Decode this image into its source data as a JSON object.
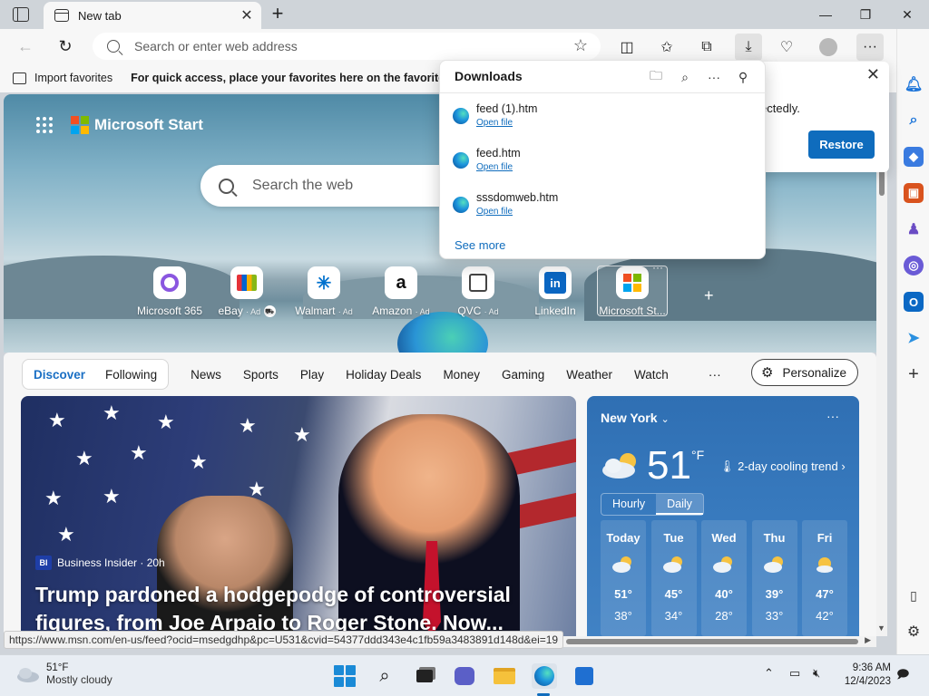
{
  "browser": {
    "tab_title": "New tab",
    "address_placeholder": "Search or enter web address",
    "favorites": {
      "import_label": "Import favorites",
      "hint": "For quick access, place your favorites here on the favorites bar."
    },
    "status_url": "https://www.msn.com/en-us/feed?ocid=msedgdhp&pc=U531&cvid=54377ddd343e4c1fb59a3483891d148d&ei=19"
  },
  "notice": {
    "text_fragment": "ectedly.",
    "restore_label": "Restore"
  },
  "downloads": {
    "title": "Downloads",
    "items": [
      {
        "name": "feed (1).htm",
        "action": "Open file"
      },
      {
        "name": "feed.htm",
        "action": "Open file"
      },
      {
        "name": "sssdomweb.htm",
        "action": "Open file"
      }
    ],
    "see_more": "See more"
  },
  "start_page": {
    "brand": "Microsoft Start",
    "search_placeholder": "Search the web",
    "quick_links": [
      {
        "label": "Microsoft 365",
        "ad": ""
      },
      {
        "label": "eBay",
        "ad": "· Ad"
      },
      {
        "label": "Walmart",
        "ad": "· Ad"
      },
      {
        "label": "Amazon",
        "ad": "· Ad"
      },
      {
        "label": "QVC",
        "ad": "· Ad"
      },
      {
        "label": "LinkedIn",
        "ad": ""
      },
      {
        "label": "Microsoft St...",
        "ad": ""
      }
    ],
    "feed_tabs": {
      "primary": [
        "Discover",
        "Following"
      ],
      "categories": [
        "News",
        "Sports",
        "Play",
        "Holiday Deals",
        "Money",
        "Gaming",
        "Weather",
        "Watch"
      ],
      "more": "···",
      "personalize": "Personalize"
    },
    "news": {
      "source_badge": "BI",
      "source": "Business Insider · 20h",
      "headline": "Trump pardoned a hodgepodge of controversial figures, from Joe Arpaio to Roger Stone. Now..."
    },
    "weather": {
      "city": "New York",
      "temp": "51",
      "unit": "°F",
      "trend": "2-day cooling trend",
      "tabs": [
        "Hourly",
        "Daily"
      ],
      "days": [
        {
          "day": "Today",
          "hi": "51°",
          "lo": "38°"
        },
        {
          "day": "Tue",
          "hi": "45°",
          "lo": "34°"
        },
        {
          "day": "Wed",
          "hi": "40°",
          "lo": "28°"
        },
        {
          "day": "Thu",
          "hi": "39°",
          "lo": "33°"
        },
        {
          "day": "Fri",
          "hi": "47°",
          "lo": "42°"
        }
      ]
    }
  },
  "taskbar": {
    "weather_temp": "51°F",
    "weather_desc": "Mostly cloudy",
    "time": "9:36 AM",
    "date": "12/4/2023"
  },
  "colors": {
    "accent": "#0f6cbd",
    "weather_bg": "#3779bd"
  }
}
